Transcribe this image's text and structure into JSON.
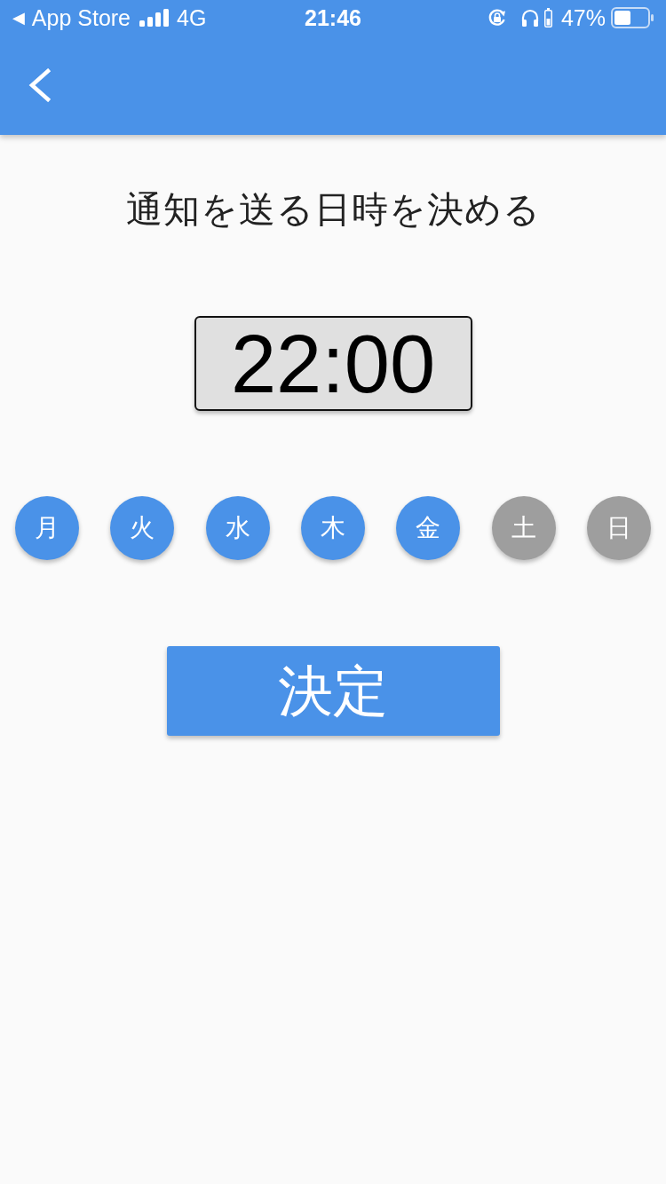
{
  "status_bar": {
    "back_arrow": "◀",
    "back_app": "App Store",
    "network": "4G",
    "time": "21:46",
    "battery_percent": "47%"
  },
  "title": "通知を送る日時を決める",
  "time_display": "22:00",
  "days": [
    {
      "label": "月",
      "selected": true
    },
    {
      "label": "火",
      "selected": true
    },
    {
      "label": "水",
      "selected": true
    },
    {
      "label": "木",
      "selected": true
    },
    {
      "label": "金",
      "selected": true
    },
    {
      "label": "土",
      "selected": false
    },
    {
      "label": "日",
      "selected": false
    }
  ],
  "confirm_button": "決定"
}
